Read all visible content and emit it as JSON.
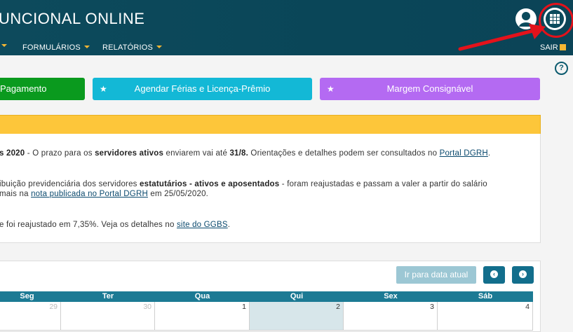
{
  "header": {
    "title": "UNCIONAL ONLINE",
    "nav": [
      "FORMULÁRIOS",
      "RELATÓRIOS"
    ],
    "logout": "SAIR"
  },
  "help": "?",
  "actions": {
    "payment": "Pagamento",
    "vacation": "Agendar Férias e Licença-Prêmio",
    "margin": "Margem Consignável"
  },
  "notices": {
    "n1": {
      "a": "s 2020",
      "b": " - O prazo para os ",
      "c": "servidores ativos",
      "d": " enviarem vai até ",
      "e": "31/8.",
      "f": " Orientações e detalhes podem ser consultados no ",
      "link": "Portal DGRH",
      "g": "."
    },
    "n2": {
      "a": "ibuição previdenciária dos servidores ",
      "b": "estatutários - ativos e aposentados",
      "c": " - foram reajustadas e passam a valer a partir do salário"
    },
    "n3": {
      "a": "mais na ",
      "link": "nota publicada no Portal DGRH",
      "b": " em 25/05/2020."
    },
    "n4": {
      "a": "e foi reajustado em 7,35%. Veja os detalhes no ",
      "link": "site do GGBS",
      "b": "."
    }
  },
  "calendar": {
    "today_button": "Ir para data atual",
    "days": [
      "Seg",
      "Ter",
      "Qua",
      "Qui",
      "Sex",
      "Sáb"
    ],
    "dates": [
      "29",
      "30",
      "1",
      "2",
      "3",
      "4"
    ]
  },
  "icons": {
    "user": "user-icon",
    "apps": "grid-icon",
    "prev": "chevron-left-icon",
    "next": "chevron-right-icon",
    "star": "star-icon"
  },
  "colors": {
    "header": "#0b4a5c",
    "accent": "#f7b733",
    "green": "#0a9a1e",
    "cyan": "#13b8d6",
    "purple": "#b46af2",
    "banner": "#fdc63a",
    "annotation": "#e3121b"
  }
}
